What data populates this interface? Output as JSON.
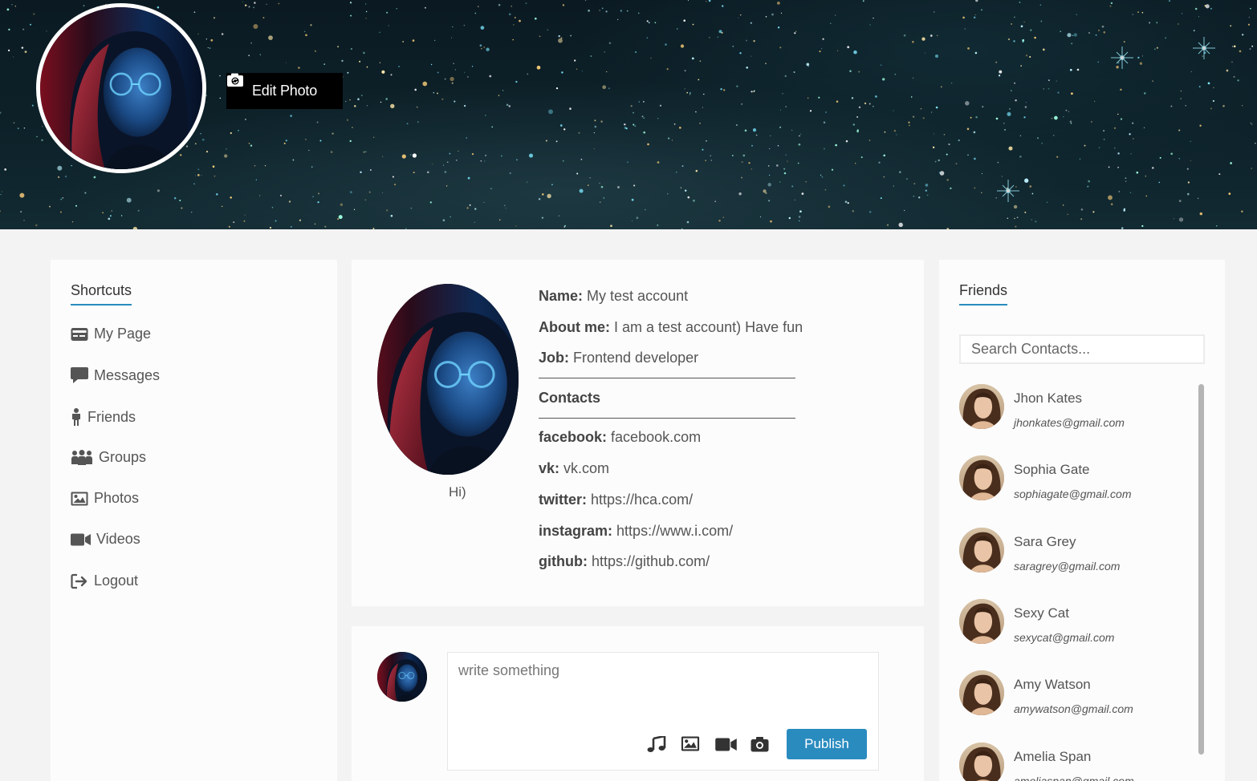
{
  "cover": {
    "edit_photo_label": "Edit Photo",
    "edit_icon": "camera-retro-icon"
  },
  "sidebar": {
    "title": "Shortcuts",
    "items": [
      {
        "label": "My Page",
        "icon": "id-card-icon"
      },
      {
        "label": "Messages",
        "icon": "comment-icon"
      },
      {
        "label": "Friends",
        "icon": "person-icon"
      },
      {
        "label": "Groups",
        "icon": "users-icon"
      },
      {
        "label": "Photos",
        "icon": "image-icon"
      },
      {
        "label": "Videos",
        "icon": "video-camera-icon"
      },
      {
        "label": "Logout",
        "icon": "sign-out-icon"
      }
    ]
  },
  "profile": {
    "status": "Hi)",
    "name_label": "Name:",
    "name": "My test account",
    "about_label": "About me:",
    "about": "I am a test account) Have fun",
    "job_label": "Job:",
    "job": "Frontend developer",
    "contacts_title": "Contacts",
    "contacts": [
      {
        "label": "facebook:",
        "value": "facebook.com"
      },
      {
        "label": "vk:",
        "value": "vk.com"
      },
      {
        "label": "twitter:",
        "value": "https://hca.com/"
      },
      {
        "label": "instagram:",
        "value": "https://www.i.com/"
      },
      {
        "label": "github:",
        "value": "https://github.com/"
      }
    ]
  },
  "composer": {
    "placeholder": "write something",
    "publish_label": "Publish",
    "tools": [
      "music-icon",
      "image-icon",
      "video-camera-icon",
      "camera-icon"
    ]
  },
  "friends": {
    "title": "Friends",
    "search_placeholder": "Search Contacts...",
    "list": [
      {
        "name": "Jhon Kates",
        "email": "jhonkates@gmail.com"
      },
      {
        "name": "Sophia Gate",
        "email": "sophiagate@gmail.com"
      },
      {
        "name": "Sara Grey",
        "email": "saragrey@gmail.com"
      },
      {
        "name": "Sexy Cat",
        "email": "sexycat@gmail.com"
      },
      {
        "name": "Amy Watson",
        "email": "amywatson@gmail.com"
      },
      {
        "name": "Amelia Span",
        "email": "ameliaspan@gmail.com"
      }
    ]
  },
  "colors": {
    "accent": "#2a8bbf",
    "page_bg": "#f4f3f3",
    "card_bg": "#fcfcfc",
    "cover_bg": "#0d2129"
  }
}
